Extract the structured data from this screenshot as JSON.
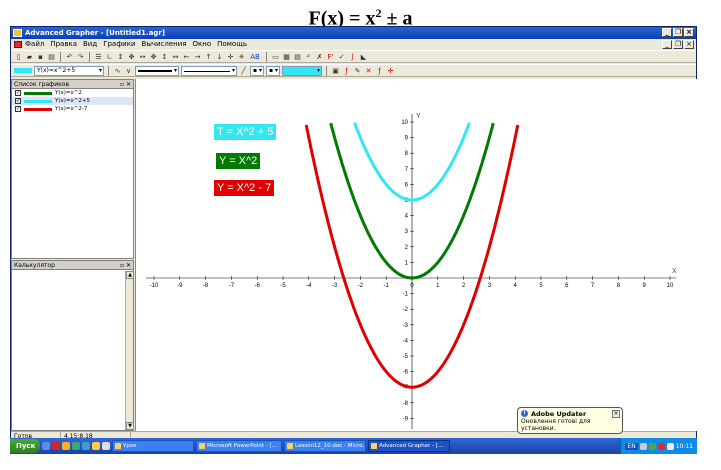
{
  "heading": {
    "base": "F(x) = x",
    "sup": "2",
    "rest": " ± a"
  },
  "window": {
    "title": "Advanced Grapher - [Untitled1.agr]"
  },
  "menu": [
    "Файл",
    "Правка",
    "Вид",
    "Графики",
    "Вычисления",
    "Окно",
    "Помощь"
  ],
  "toolbar2": {
    "expr": "Y(x)=x^2+5",
    "grid_label": "AB"
  },
  "graphs_panel": {
    "title": "Список графиков",
    "items": [
      {
        "label": "Y(x)=x^2",
        "color": "#007a00"
      },
      {
        "label": "Y(x)=x^2+5",
        "color": "#33e6f0"
      },
      {
        "label": "Y(x)=x^2-7",
        "color": "#e00000"
      }
    ]
  },
  "calc_panel": {
    "title": "Калькулятор"
  },
  "legend": [
    {
      "text": "T = X^2 + 5",
      "bg": "#33e6f0"
    },
    {
      "text": "Y = X^2",
      "bg": "#007a00"
    },
    {
      "text": "Y = X^2 - 7",
      "bg": "#e00000"
    }
  ],
  "axes": {
    "xlabel": "X",
    "ylabel": "Y"
  },
  "status": {
    "state": "Готов",
    "coords": "4.15:8.18"
  },
  "taskbar": {
    "start": "Пуск",
    "tasks": [
      "Урок",
      "Microsoft PowerPoint - [...",
      "Lesson12_10.doc - Micro...",
      "Advanced Grapher - [..."
    ],
    "lang": "EN",
    "clock": "10:11"
  },
  "balloon": {
    "title": "Adobe Updater",
    "text": "Оновлення готові для установки."
  },
  "chart_data": {
    "type": "line",
    "xlim": [
      -10,
      10
    ],
    "ylim": [
      -10,
      10
    ],
    "xticks": [
      -10,
      -9,
      -8,
      -7,
      -6,
      -5,
      -4,
      -3,
      -2,
      -1,
      0,
      1,
      2,
      3,
      4,
      5,
      6,
      7,
      8,
      9,
      10
    ],
    "yticks": [
      -10,
      -9,
      -8,
      -7,
      -6,
      -5,
      -4,
      -3,
      -2,
      -1,
      1,
      2,
      3,
      4,
      5,
      6,
      7,
      8,
      9,
      10
    ],
    "grid": false,
    "series": [
      {
        "name": "Y(x)=x^2",
        "a": 1,
        "c": 0,
        "color": "#007a00"
      },
      {
        "name": "Y(x)=x^2+5",
        "a": 1,
        "c": 5,
        "color": "#33e6f0"
      },
      {
        "name": "Y(x)=x^2-7",
        "a": 1,
        "c": -7,
        "color": "#e00000"
      }
    ]
  }
}
